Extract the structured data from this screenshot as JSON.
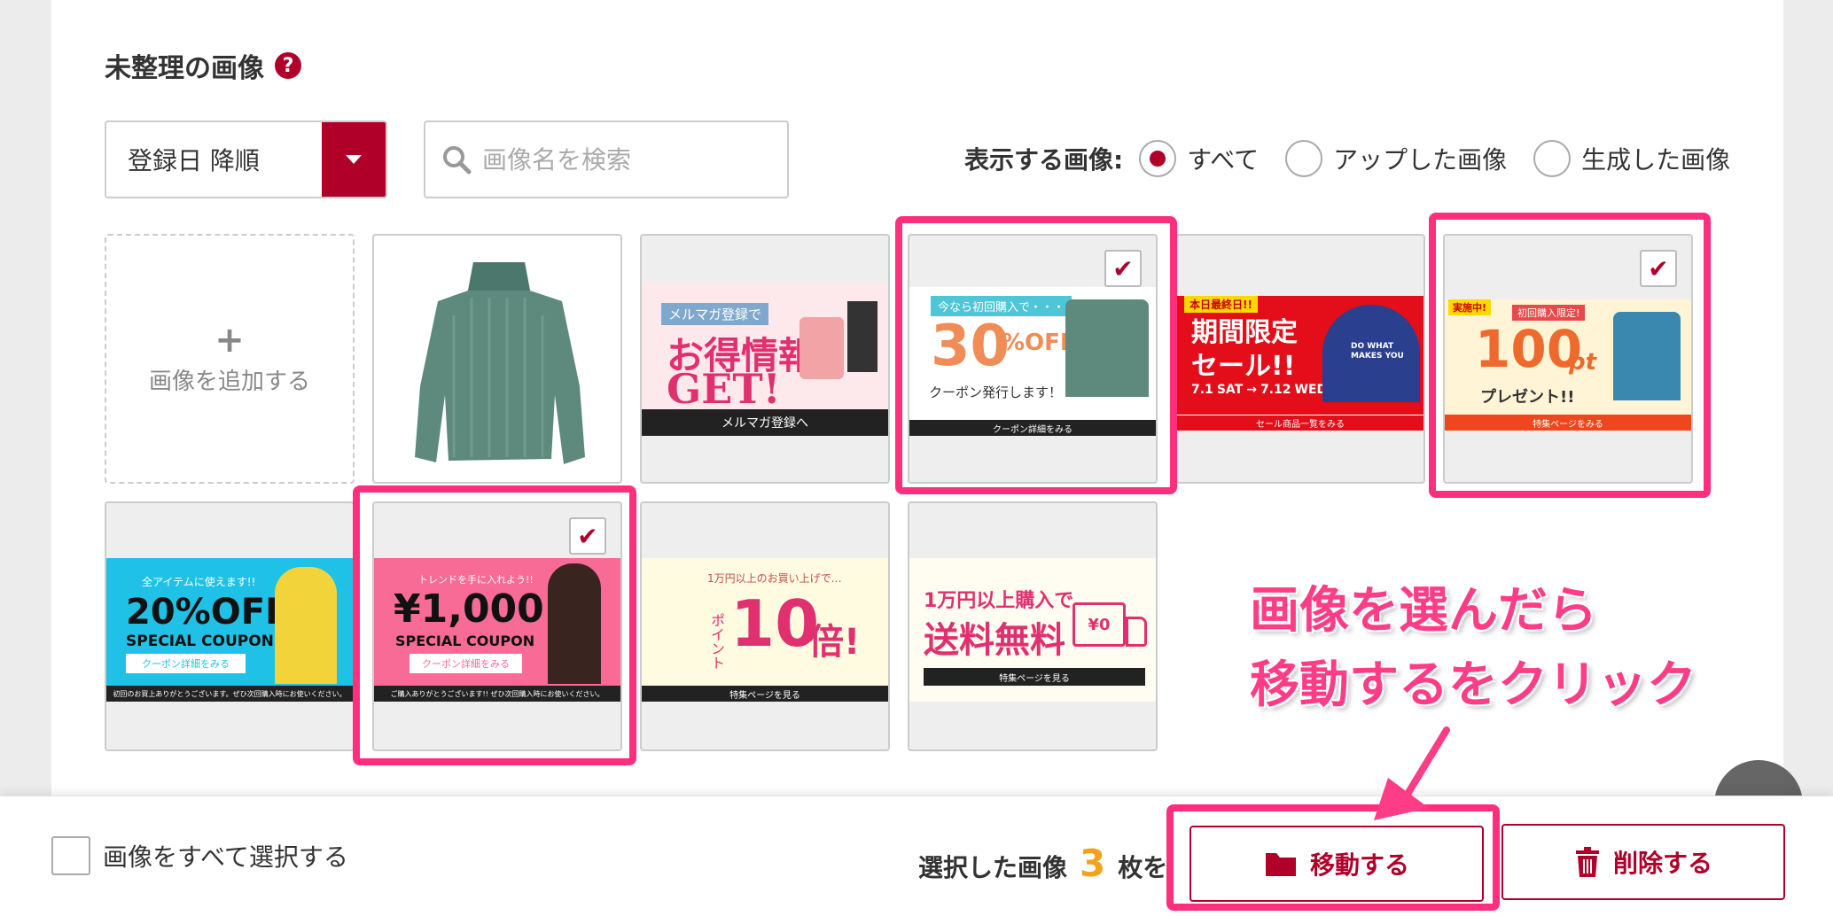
{
  "section": {
    "title": "未整理の画像",
    "help_icon": "?"
  },
  "sort": {
    "value": "登録日 降順"
  },
  "search": {
    "placeholder": "画像名を検索"
  },
  "filter": {
    "label": "表示する画像:",
    "options": [
      {
        "label": "すべて",
        "selected": true
      },
      {
        "label": "アップした画像",
        "selected": false
      },
      {
        "label": "生成した画像",
        "selected": false
      }
    ]
  },
  "add_tile": {
    "plus": "+",
    "label": "画像を追加する"
  },
  "images": [
    {
      "name": "sweater",
      "checked": false
    },
    {
      "name": "banner-mailmag",
      "checked": false,
      "lines": [
        "メルマガ登録で",
        "お得情報",
        "GET!",
        "メルマガ登録へ"
      ]
    },
    {
      "name": "banner-30off",
      "checked": true,
      "lines": [
        "今なら初回購入で・・・",
        "30",
        "%OFF",
        "クーポン発行します！",
        "クーポン詳細をみる"
      ]
    },
    {
      "name": "banner-sale",
      "checked": false,
      "lines": [
        "本日最終日!!",
        "期間限定",
        "セール!!",
        "7.1",
        "SAT",
        "7.12",
        "WED",
        "セール商品一覧をみる",
        "DO WHAT MAKES YOU"
      ]
    },
    {
      "name": "banner-100pt",
      "checked": true,
      "lines": [
        "実施中!",
        "初回購入限定!",
        "100",
        "pt",
        "プレゼント!!",
        "特集ページをみる"
      ]
    },
    {
      "name": "banner-20off",
      "checked": false,
      "lines": [
        "全アイテムに使えます!!",
        "20%OFF",
        "SPECIAL COUPON",
        "クーポン詳細をみる",
        "初回のお買上ありがとうございます。ぜひ次回購入時にお使いください。"
      ]
    },
    {
      "name": "banner-1000yen",
      "checked": true,
      "lines": [
        "トレンドを手に入れよう!!",
        "¥1,000",
        "SPECIAL COUPON",
        "クーポン詳細をみる",
        "ご購入ありがとうございます!! ぜひ次回購入時にお使いください。"
      ]
    },
    {
      "name": "banner-10x",
      "checked": false,
      "lines": [
        "1万円以上のお買い上げで…",
        "ポイント",
        "10",
        "倍!",
        "特集ページを見る"
      ]
    },
    {
      "name": "banner-freeship",
      "checked": false,
      "lines": [
        "1万円以上購入で",
        "送料無料",
        "¥0",
        "特集ページを見る"
      ]
    }
  ],
  "annotation": {
    "line1": "画像を選んだら",
    "line2": "移動するをクリック"
  },
  "bottom": {
    "select_all_label": "画像をすべて選択する",
    "selected_prefix": "選択した画像",
    "selected_count": "3",
    "selected_suffix": "枚を",
    "move_label": "移動する",
    "delete_label": "削除する"
  },
  "colors": {
    "accent": "#b0002a",
    "highlight": "#ff2f7d",
    "count": "#f5a21b"
  }
}
